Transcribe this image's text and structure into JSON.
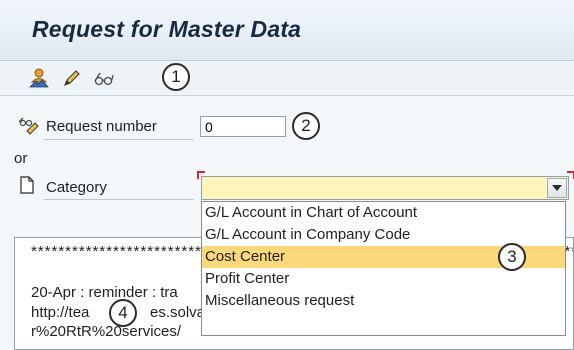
{
  "header": {
    "title": "Request for Master Data"
  },
  "toolbar": {
    "icons": [
      "user-create-icon",
      "pencil-edit-icon",
      "glasses-display-icon"
    ]
  },
  "callouts": [
    "1",
    "2",
    "3",
    "4"
  ],
  "form": {
    "request_number_label": "Request number",
    "request_number_value": "0",
    "or_label": "or",
    "category_label": "Category",
    "category_value": ""
  },
  "dropdown": {
    "options": [
      "G/L Account in Chart of Account",
      "G/L Account in Company Code",
      "Cost Center",
      "Profit Center",
      "Miscellaneous request"
    ],
    "selected": "Cost Center"
  },
  "notes": {
    "line1": "**************************************************************************************",
    "line2": "20-Apr : reminder : tra",
    "line3": "http://tea",
    "line3b": "es.solva",
    "line4": "r%20RtR%20services/"
  },
  "colors": {
    "dropdown_highlight": "#fbd87a",
    "field_required": "#fff5b8",
    "title": "#172a40"
  }
}
